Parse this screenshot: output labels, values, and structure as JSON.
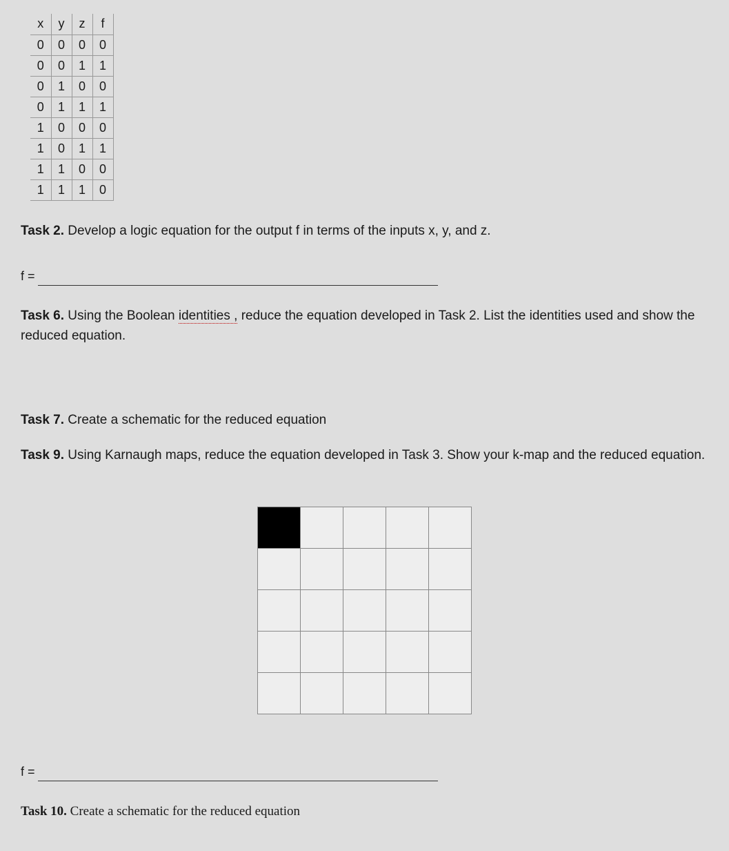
{
  "truth_table": {
    "headers": [
      "x",
      "y",
      "z",
      "f"
    ],
    "rows": [
      [
        "0",
        "0",
        "0",
        "0"
      ],
      [
        "0",
        "0",
        "1",
        "1"
      ],
      [
        "0",
        "1",
        "0",
        "0"
      ],
      [
        "0",
        "1",
        "1",
        "1"
      ],
      [
        "1",
        "0",
        "0",
        "0"
      ],
      [
        "1",
        "0",
        "1",
        "1"
      ],
      [
        "1",
        "1",
        "0",
        "0"
      ],
      [
        "1",
        "1",
        "1",
        "0"
      ]
    ]
  },
  "task2": {
    "label": "Task 2.",
    "text": " Develop a logic equation for the output f in terms of the inputs x, y, and z."
  },
  "equation1_label": "f =",
  "task6": {
    "label": "Task 6.",
    "text_part1": " Using the Boolean ",
    "link_text": "identities ,",
    "text_part2": " reduce the equation developed in Task 2.  List the identities used and show the reduced equation."
  },
  "task7": {
    "label": "Task 7.",
    "text": " Create a schematic for the reduced equation"
  },
  "task9": {
    "label": "Task 9.",
    "text": "  Using Karnaugh maps, reduce the equation developed in Task 3.  Show your k-map and the reduced equation."
  },
  "kmap": {
    "rows": 5,
    "cols": 5,
    "filled": [
      [
        0,
        0
      ]
    ]
  },
  "equation2_label": "f =",
  "task10": {
    "label": "Task 10.",
    "text": "  Create a schematic for the reduced equation"
  }
}
